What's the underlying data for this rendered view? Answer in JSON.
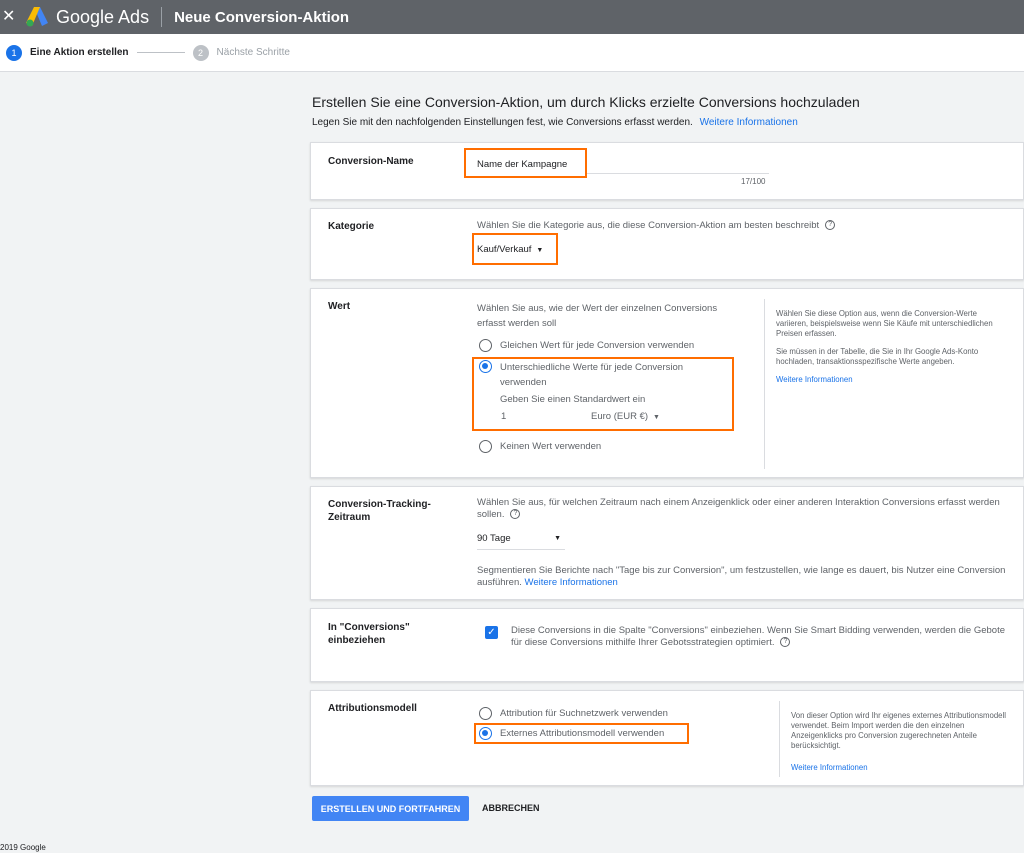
{
  "header": {
    "brand": "Google Ads",
    "title": "Neue Conversion-Aktion"
  },
  "steps": [
    {
      "num": "1",
      "label": "Eine Aktion erstellen"
    },
    {
      "num": "2",
      "label": "Nächste Schritte"
    }
  ],
  "page": {
    "heading": "Erstellen Sie eine Conversion-Aktion, um durch Klicks erzielte Conversions hochzuladen",
    "intro": "Legen Sie mit den nachfolgenden Einstellungen fest, wie Conversions erfasst werden.",
    "intro_link": "Weitere Informationen"
  },
  "conversion_name": {
    "label": "Conversion-Name",
    "value": "Name der Kampagne",
    "counter": "17/100"
  },
  "kategorie": {
    "label": "Kategorie",
    "hint": "Wählen Sie die Kategorie aus, die diese Conversion-Aktion am besten beschreibt",
    "value": "Kauf/Verkauf"
  },
  "wert": {
    "label": "Wert",
    "hint_1": "Wählen Sie aus, wie der Wert der einzelnen Conversions",
    "hint_2": "erfasst werden soll",
    "option_1": "Gleichen Wert für jede Conversion verwenden",
    "option_2a": "Unterschiedliche Werte für jede Conversion",
    "option_2b": "verwenden",
    "default_prompt": "Geben Sie einen Standardwert ein",
    "default_value": "1",
    "currency": "Euro (EUR €)",
    "option_3": "Keinen Wert verwenden",
    "side_1": "Wählen Sie diese Option aus, wenn die Conversion-Werte variieren, beispielsweise wenn Sie Käufe mit unterschiedlichen Preisen erfassen.",
    "side_2": "Sie müssen in der Tabelle, die Sie in Ihr Google Ads-Konto hochladen, transaktionsspezifische Werte angeben.",
    "side_link": "Weitere Informationen"
  },
  "tracking": {
    "label_1": "Conversion-Tracking-",
    "label_2": "Zeitraum",
    "hint": "Wählen Sie aus, für welchen Zeitraum nach einem Anzeigenklick oder einer anderen Interaktion Conversions erfasst werden sollen.",
    "value": "90 Tage",
    "note": "Segmentieren Sie Berichte nach \"Tage bis zur Conversion\", um festzustellen, wie lange es dauert, bis Nutzer eine Conversion ausführen.",
    "note_link": "Weitere Informationen"
  },
  "include": {
    "label_1": "In \"Conversions\"",
    "label_2": "einbeziehen",
    "text": "Diese Conversions in die Spalte \"Conversions\" einbeziehen. Wenn Sie Smart Bidding verwenden, werden die Gebote für diese Conversions mithilfe Ihrer Gebotsstrategien optimiert."
  },
  "attribution": {
    "label": "Attributionsmodell",
    "option_1": "Attribution für Suchnetzwerk verwenden",
    "option_2": "Externes Attributionsmodell verwenden",
    "side": "Von dieser Option wird Ihr eigenes externes Attributionsmodell verwendet. Beim Import werden die den einzelnen Anzeigenklicks pro Conversion zugerechneten Anteile berücksichtigt.",
    "side_link": "Weitere Informationen"
  },
  "actions": {
    "primary": "ERSTELLEN UND FORTFAHREN",
    "cancel": "ABBRECHEN"
  },
  "footer": "2019 Google",
  "colors": {
    "topbar": "#5f6368",
    "accent": "#1a73e8",
    "highlight": "#ff6d00"
  }
}
